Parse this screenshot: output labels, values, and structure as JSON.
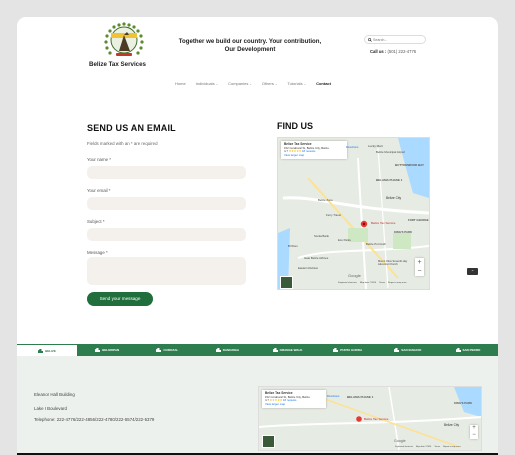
{
  "header": {
    "brand": "Belize Tax Services",
    "tagline": "Together we build our country. Your contribution, Our Development",
    "search_placeholder": "Search...",
    "call_label": "Call us :",
    "call_number": "(501) 222-4776"
  },
  "nav": [
    {
      "label": "Home",
      "dropdown": false
    },
    {
      "label": "Individuals",
      "dropdown": true
    },
    {
      "label": "Companies",
      "dropdown": true
    },
    {
      "label": "Others",
      "dropdown": true
    },
    {
      "label": "Tutorials",
      "dropdown": true
    },
    {
      "label": "Contact",
      "dropdown": false,
      "active": true
    }
  ],
  "form": {
    "title": "SEND US AN EMAIL",
    "required_note": "Fields marked with an * are required",
    "name_label": "Your name *",
    "email_label": "Your email *",
    "subject_label": "Subject *",
    "message_label": "Message *",
    "submit_label": "Send your message"
  },
  "find": {
    "title": "FIND US",
    "map_card": {
      "place": "Belize Tax Service",
      "address": "152 Coraboral St, Belize City, Belize",
      "rating": "4.7",
      "stars": "★★★★★",
      "reviews": "18 reviews",
      "larger_map": "View larger map",
      "directions": "Directions"
    },
    "pin_label": "Belize Tax Service",
    "places": [
      "Lucky Mart",
      "Belize Municipal Airport",
      "BUTTONWOOD BAY",
      "BELAMA PHASE 1",
      "Belize City",
      "Ferry Travel",
      "Gate Belize Airlines",
      "Eco Parks",
      "Scotia Bank",
      "Belize Port Auth",
      "KING'S PARK",
      "Eastern Division",
      "Belize Zone",
      "FORT GEORGE",
      "Mount Olive Seventh-day Adventist Church",
      "Bl Wom",
      "Keyboard shortcuts",
      "Map data ©2024",
      "Terms",
      "Report a map error"
    ],
    "google": "Google"
  },
  "tabs": [
    {
      "label": "BELIZE",
      "active": true
    },
    {
      "label": "BELMOPAN",
      "active": false
    },
    {
      "label": "COROZAL",
      "active": false
    },
    {
      "label": "DANGRIGA",
      "active": false
    },
    {
      "label": "ORANGE WALK",
      "active": false
    },
    {
      "label": "PUNTA GORDA",
      "active": false
    },
    {
      "label": "SAN IGNACIO",
      "active": false
    },
    {
      "label": "SAN PEDRO",
      "active": false
    }
  ],
  "office": {
    "building": "Eleanor Hall Building",
    "street": "Lake I Boulevard",
    "phones": "Telephone: 222-4776/222-4856/222-4780/222-5574/222-5379"
  },
  "colors": {
    "brand_green": "#2e7d4f",
    "button_green": "#1f6e3c",
    "pin": "#e53935"
  }
}
